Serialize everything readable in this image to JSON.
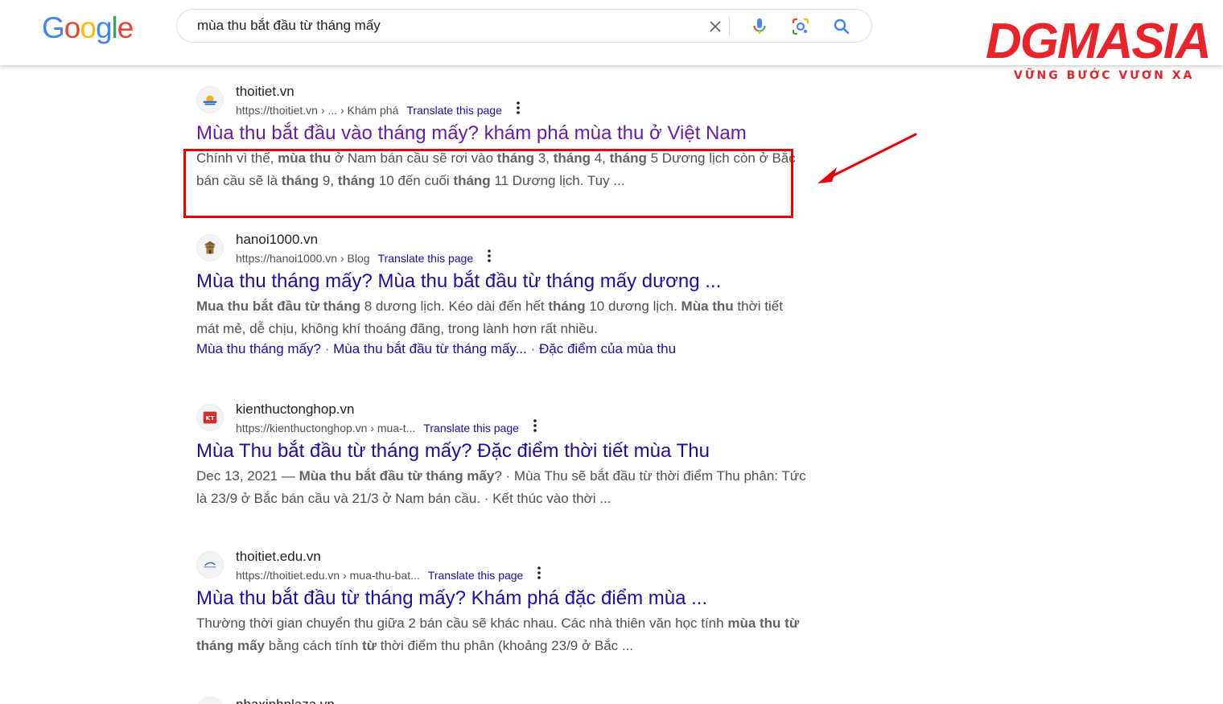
{
  "header": {
    "logo": {
      "letters": [
        "G",
        "o",
        "o",
        "g",
        "l",
        "e"
      ],
      "colors": [
        "#4285F4",
        "#EA4335",
        "#FBBC05",
        "#4285F4",
        "#34A853",
        "#EA4335"
      ]
    },
    "search": {
      "value": "mùa thu bắt đầu từ tháng mấy"
    },
    "icons": [
      "close-icon",
      "microphone-icon",
      "lens-icon",
      "search-icon"
    ]
  },
  "brand": {
    "name": "DGMASIA",
    "tagline": "VỮNG BƯỚC VƯƠN XA",
    "color": "#e8232a"
  },
  "results": [
    {
      "site": "thoitiet.vn",
      "url": "https://thoitiet.vn › ... › Khám phá",
      "translate": "Translate this page",
      "title": "Mùa thu bắt đầu vào tháng mấy? khám phá mùa thu ở Việt Nam",
      "visited": true,
      "snippet_parts": [
        {
          "t": "Chính vì thế, "
        },
        {
          "t": "mùa thu",
          "b": true
        },
        {
          "t": " ở Nam bán cầu sẽ rơi vào "
        },
        {
          "t": "tháng",
          "b": true
        },
        {
          "t": " 3, "
        },
        {
          "t": "tháng",
          "b": true
        },
        {
          "t": " 4, "
        },
        {
          "t": "tháng",
          "b": true
        },
        {
          "t": " 5 Dương lịch còn ở Bắc bán cầu sẽ là "
        },
        {
          "t": "tháng",
          "b": true
        },
        {
          "t": " 9, "
        },
        {
          "t": "tháng",
          "b": true
        },
        {
          "t": " 10 đến cuối "
        },
        {
          "t": "tháng",
          "b": true
        },
        {
          "t": " 11 Dương lịch. Tuy ..."
        }
      ]
    },
    {
      "site": "hanoi1000.vn",
      "url": "https://hanoi1000.vn › Blog",
      "translate": "Translate this page",
      "title": "Mùa thu tháng mấy? Mùa thu bắt đầu từ tháng mấy dương ...",
      "visited": false,
      "snippet_parts": [
        {
          "t": "Mua thu bắt đầu từ tháng",
          "b": true
        },
        {
          "t": " 8 dương lịch. Kéo dài đến hết "
        },
        {
          "t": "tháng",
          "b": true
        },
        {
          "t": " 10 dương lịch. "
        },
        {
          "t": "Mùa thu",
          "b": true
        },
        {
          "t": " thời tiết mát mẻ, dễ chịu, không khí thoáng đãng, trong lành hơn rất nhiều."
        }
      ],
      "sitelinks": [
        "Mùa thu tháng mấy?",
        "Mùa thu bắt đầu từ tháng mấy...",
        "Đặc điểm của mùa thu"
      ],
      "sitelink_sep": "·"
    },
    {
      "site": "kienthuctonghop.vn",
      "url": "https://kienthuctonghop.vn › mua-t...",
      "translate": "Translate this page",
      "title": "Mùa Thu bắt đầu từ tháng mấy? Đặc điểm thời tiết mùa Thu",
      "visited": false,
      "snippet_parts": [
        {
          "t": "Dec 13, 2021 — "
        },
        {
          "t": "Mùa thu bắt đầu từ tháng mấy",
          "b": true
        },
        {
          "t": "? · Mùa Thu sẽ bắt đầu từ thời điểm Thu phân: Tức là 23/9 ở Bắc bán cầu và 21/3 ở Nam bán cầu. · Kết thúc vào thời ..."
        }
      ]
    },
    {
      "site": "thoitiet.edu.vn",
      "url": "https://thoitiet.edu.vn › mua-thu-bat...",
      "translate": "Translate this page",
      "title": "Mùa thu bắt đầu từ tháng mấy? Khám phá đặc điểm mùa ...",
      "visited": false,
      "snippet_parts": [
        {
          "t": "Thường thời gian chuyển thu giữa 2 bán cầu sẽ khác nhau. Các nhà thiên văn học tính "
        },
        {
          "t": "mùa thu từ tháng mấy",
          "b": true
        },
        {
          "t": " bằng cách tính "
        },
        {
          "t": "từ",
          "b": true
        },
        {
          "t": " thời điểm thu phân (khoảng 23/9 ở Bắc ..."
        }
      ]
    },
    {
      "site": "nhaxinhplaza.vn"
    }
  ],
  "annotation": {
    "box_color": "#e8000b"
  }
}
